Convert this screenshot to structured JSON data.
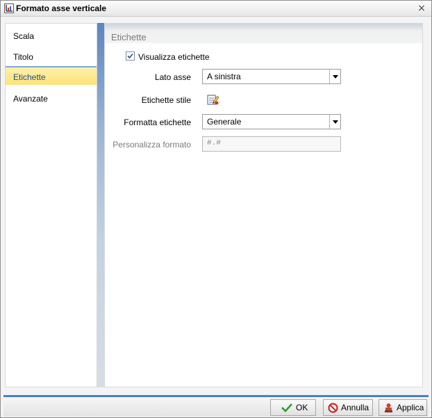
{
  "window": {
    "title": "Formato asse verticale",
    "close_label": "×"
  },
  "nav": {
    "items": [
      {
        "label": "Scala"
      },
      {
        "label": "Titolo"
      },
      {
        "label": "Etichette",
        "active": true
      },
      {
        "label": "Avanzate"
      }
    ]
  },
  "panel": {
    "title": "Etichette",
    "show_labels": {
      "label": "Visualizza etichette",
      "checked": true
    },
    "axis_side": {
      "label": "Lato asse",
      "value": "A sinistra"
    },
    "label_style": {
      "label": "Etichette stile",
      "icon": "style-edit-icon"
    },
    "label_format": {
      "label": "Formatta etichette",
      "value": "Generale"
    },
    "custom_format": {
      "label": "Personalizza formato",
      "value": "#.#"
    }
  },
  "buttons": {
    "ok": "OK",
    "cancel": "Annulla",
    "apply": "Applica"
  },
  "colors": {
    "accent_blue": "#4a7fc1",
    "active_nav": "#ffe27a"
  }
}
